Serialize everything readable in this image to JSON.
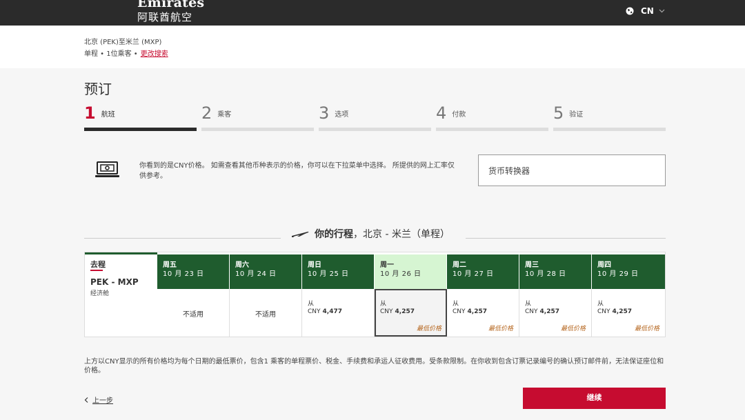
{
  "header": {
    "logo_en": "Emirates",
    "logo_cn": "阿联酋航空",
    "language": "CN"
  },
  "summary": {
    "route": "北京 (PEK)至米兰 (MXP)",
    "trip": "单程 • 1位乘客 •",
    "modify_link": "更改搜索"
  },
  "page_title": "预订",
  "steps": [
    {
      "num": "1",
      "label": "航班",
      "active": true
    },
    {
      "num": "2",
      "label": "乘客",
      "active": false
    },
    {
      "num": "3",
      "label": "选项",
      "active": false
    },
    {
      "num": "4",
      "label": "付款",
      "active": false
    },
    {
      "num": "5",
      "label": "验证",
      "active": false
    }
  ],
  "currency_notice": {
    "text": "你看到的是CNY价格。 如需查看其他币种表示的价格，你可以在下拉菜单中选择。 所提供的网上汇率仅供参考。",
    "converter_label": "货币转换器"
  },
  "itinerary": {
    "title_bold": "你的行程",
    "title_rest": "，北京 - 米兰（单程）"
  },
  "outbound": {
    "label": "去程",
    "route": "PEK - MXP",
    "cabin": "经济舱"
  },
  "days": [
    {
      "day": "周五",
      "date": "10 月 23 日",
      "available": false,
      "na_text": "不适用"
    },
    {
      "day": "周六",
      "date": "10 月 24 日",
      "available": false,
      "na_text": "不适用"
    },
    {
      "day": "周日",
      "date": "10 月 25 日",
      "available": true,
      "from": "从",
      "currency": "CNY",
      "price": "4,477",
      "lowest": ""
    },
    {
      "day": "周一",
      "date": "10 月 26 日",
      "available": true,
      "selected": true,
      "from": "从",
      "currency": "CNY",
      "price": "4,257",
      "lowest": "最低价格"
    },
    {
      "day": "周二",
      "date": "10 月 27 日",
      "available": true,
      "from": "从",
      "currency": "CNY",
      "price": "4,257",
      "lowest": "最低价格"
    },
    {
      "day": "周三",
      "date": "10 月 28 日",
      "available": true,
      "from": "从",
      "currency": "CNY",
      "price": "4,257",
      "lowest": "最低价格"
    },
    {
      "day": "周四",
      "date": "10 月 29 日",
      "available": true,
      "from": "从",
      "currency": "CNY",
      "price": "4,257",
      "lowest": "最低价格"
    }
  ],
  "disclaimer": "上方以CNY显示的所有价格均为每个日期的最低票价，包含1 乘客的单程票价、税金、手续费和承运人征收费用。受条款限制。在你收到包含订票记录编号的确认预订邮件前，无法保证座位和价格。",
  "nav": {
    "back": "上一步",
    "continue": "继续"
  },
  "colors": {
    "brand_red": "#c60c30",
    "header_green": "#1f5c2e",
    "selected_green": "#d6f5d2"
  }
}
